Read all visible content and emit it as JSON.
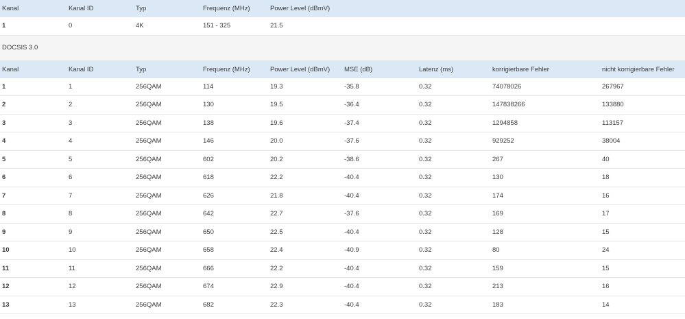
{
  "table1": {
    "headers": [
      "Kanal",
      "Kanal ID",
      "Typ",
      "Frequenz (MHz)",
      "Power Level (dBmV)"
    ],
    "rows": [
      [
        "1",
        "0",
        "4K",
        "151 - 325",
        "21.5"
      ]
    ]
  },
  "section_label": "DOCSIS 3.0",
  "table2": {
    "headers": [
      "Kanal",
      "Kanal ID",
      "Typ",
      "Frequenz (MHz)",
      "Power Level (dBmV)",
      "MSE (dB)",
      "Latenz (ms)",
      "korrigierbare Fehler",
      "nicht korrigierbare Fehler"
    ],
    "rows": [
      [
        "1",
        "1",
        "256QAM",
        "114",
        "19.3",
        "-35.8",
        "0.32",
        "74078026",
        "267967"
      ],
      [
        "2",
        "2",
        "256QAM",
        "130",
        "19.5",
        "-36.4",
        "0.32",
        "147838266",
        "133880"
      ],
      [
        "3",
        "3",
        "256QAM",
        "138",
        "19.6",
        "-37.4",
        "0.32",
        "1294858",
        "113157"
      ],
      [
        "4",
        "4",
        "256QAM",
        "146",
        "20.0",
        "-37.6",
        "0.32",
        "929252",
        "38004"
      ],
      [
        "5",
        "5",
        "256QAM",
        "602",
        "20.2",
        "-38.6",
        "0.32",
        "267",
        "40"
      ],
      [
        "6",
        "6",
        "256QAM",
        "618",
        "22.2",
        "-40.4",
        "0.32",
        "130",
        "18"
      ],
      [
        "7",
        "7",
        "256QAM",
        "626",
        "21.8",
        "-40.4",
        "0.32",
        "174",
        "16"
      ],
      [
        "8",
        "8",
        "256QAM",
        "642",
        "22.7",
        "-37.6",
        "0.32",
        "169",
        "17"
      ],
      [
        "9",
        "9",
        "256QAM",
        "650",
        "22.5",
        "-40.4",
        "0.32",
        "128",
        "15"
      ],
      [
        "10",
        "10",
        "256QAM",
        "658",
        "22.4",
        "-40.9",
        "0.32",
        "80",
        "24"
      ],
      [
        "11",
        "11",
        "256QAM",
        "666",
        "22.2",
        "-40.4",
        "0.32",
        "159",
        "15"
      ],
      [
        "12",
        "12",
        "256QAM",
        "674",
        "22.9",
        "-40.4",
        "0.32",
        "213",
        "16"
      ],
      [
        "13",
        "13",
        "256QAM",
        "682",
        "22.3",
        "-40.4",
        "0.32",
        "183",
        "14"
      ]
    ]
  }
}
